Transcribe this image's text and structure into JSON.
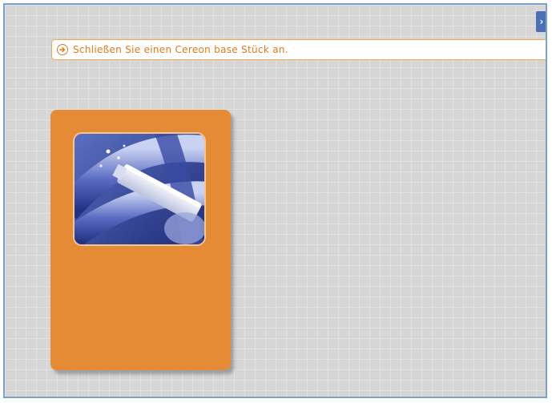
{
  "instruction": {
    "icon": "arrow-right-circle-icon",
    "text": "Schließen Sie einen Cereon base Stück an."
  },
  "corner_control": {
    "icon": "chevron-right-icon",
    "glyph": "›"
  },
  "card": {
    "image": "usb-stick-photo",
    "colors": {
      "card": "#e58a35",
      "image_tint": "#2e3f96"
    }
  },
  "colors": {
    "background": "#d6d6d6",
    "grid": "#e2e2e2",
    "frame_border": "#7aa0cc",
    "accent_orange": "#e07a1c"
  }
}
